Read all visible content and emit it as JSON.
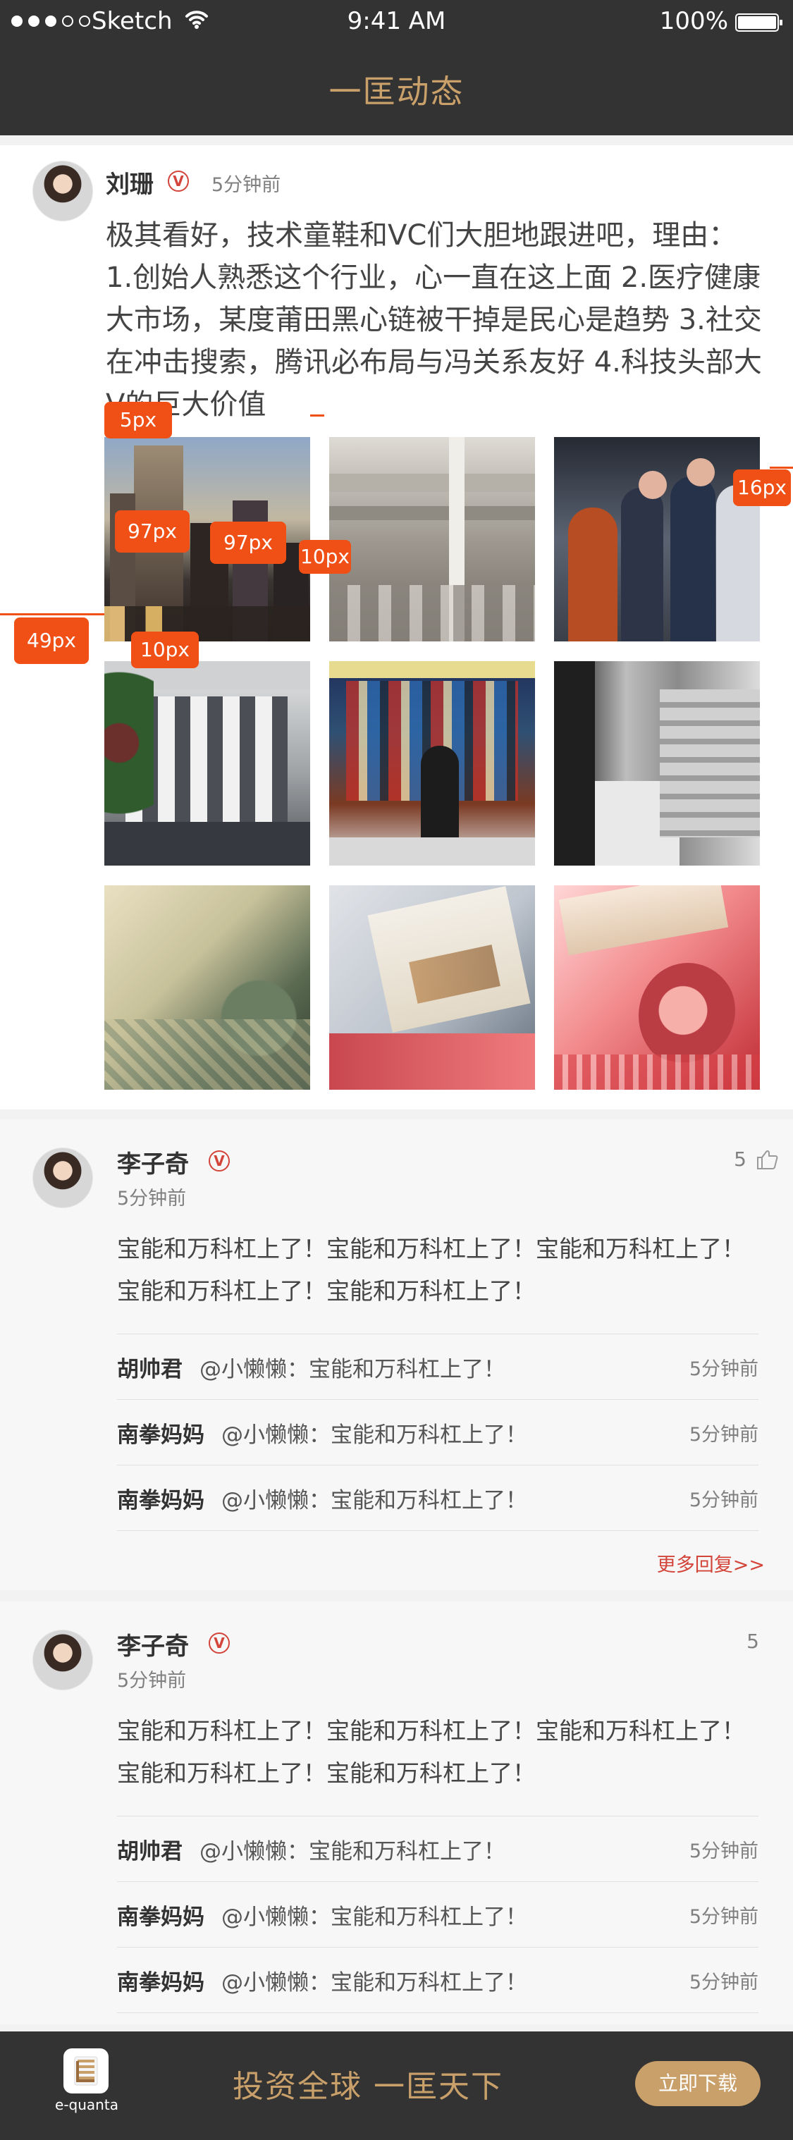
{
  "status_bar": {
    "carrier": "Sketch",
    "time": "9:41 AM",
    "battery": "100%"
  },
  "header": {
    "title": "一匡动态"
  },
  "post": {
    "author": "刘珊",
    "verified_badge": "V",
    "time": "5分钟前",
    "text": "极其看好，技术童鞋和VC们大胆地跟进吧，理由：1.创始人熟悉这个行业，心一直在这上面 2.医疗健康大市场，某度莆田黑心链被干掉是民心是趋势 3.社交在冲击搜索，腾讯必布局与冯关系友好 4.科技头部大V的巨大价值",
    "images": [
      "city-skyline-image",
      "stone-column-image",
      "trading-floor-image",
      "stock-exchange-building-image",
      "street-mural-image",
      "subway-train-image",
      "dollar-bill-image",
      "euro-note-image",
      "rmb-note-image"
    ],
    "annotations": {
      "a": "5px",
      "b": "97px",
      "c": "97px",
      "d": "10px",
      "e": "10px",
      "f": "49px",
      "g": "16px"
    }
  },
  "comments": [
    {
      "author": "李子奇",
      "verified_badge": "V",
      "time": "5分钟前",
      "likes": "5",
      "text": "宝能和万科杠上了！宝能和万科杠上了！宝能和万科杠上了！宝能和万科杠上了！宝能和万科杠上了！",
      "replies": [
        {
          "name": "胡帅君",
          "text": "@小懒懒：宝能和万科杠上了！",
          "time": "5分钟前"
        },
        {
          "name": "南拳妈妈",
          "text": "@小懒懒：宝能和万科杠上了！",
          "time": "5分钟前"
        },
        {
          "name": "南拳妈妈",
          "text": "@小懒懒：宝能和万科杠上了！",
          "time": "5分钟前"
        }
      ],
      "more_link": "更多回复>>"
    },
    {
      "author": "李子奇",
      "verified_badge": "V",
      "time": "5分钟前",
      "likes": "5",
      "text": "宝能和万科杠上了！宝能和万科杠上了！宝能和万科杠上了！宝能和万科杠上了！宝能和万科杠上了！",
      "replies": [
        {
          "name": "胡帅君",
          "text": "@小懒懒：宝能和万科杠上了！",
          "time": "5分钟前"
        },
        {
          "name": "南拳妈妈",
          "text": "@小懒懒：宝能和万科杠上了！",
          "time": "5分钟前"
        },
        {
          "name": "南拳妈妈",
          "text": "@小懒懒：宝能和万科杠上了！",
          "time": "5分钟前"
        }
      ]
    }
  ],
  "bottom_bar": {
    "logo_text": "e-quanta",
    "slogan": "投资全球 一匡天下",
    "download_label": "立即下载"
  },
  "colors": {
    "dark_bg": "#333333",
    "gold": "#c9a06a",
    "accent_red": "#d3453a",
    "annotation_orange": "#f04f16"
  }
}
